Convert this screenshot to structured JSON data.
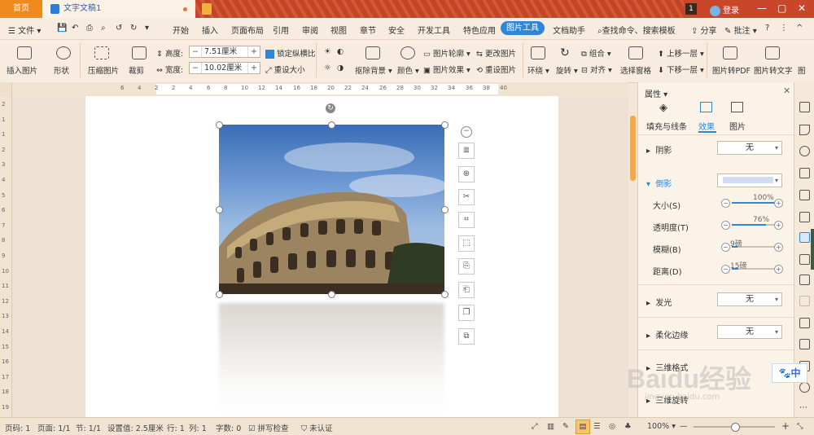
{
  "titlebar": {
    "home_tab": "首页",
    "doc_tab": "文字文稿1",
    "badge": "1",
    "login": "登录",
    "min": "—",
    "max": "▢",
    "close": "✕"
  },
  "menu": {
    "file": "文件",
    "items": [
      "开始",
      "插入",
      "页面布局",
      "引用",
      "审阅",
      "视图",
      "章节",
      "安全",
      "开发工具",
      "特色应用"
    ],
    "active": "图片工具",
    "assistant": "文档助手",
    "search": "查找命令、搜索模板",
    "share": "分享",
    "comment": "批注"
  },
  "ribbon": {
    "insert_picture": "插入图片",
    "shape": "形状",
    "compress": "压缩图片",
    "crop": "裁剪",
    "height_label": "高度:",
    "height_value": "7.51厘米",
    "width_label": "宽度:",
    "width_value": "10.02厘米",
    "lock_ratio": "锁定纵横比",
    "reset_size": "重设大小",
    "remove_bg": "抠除背景",
    "color": "颜色",
    "outline": "图片轮廓",
    "effect": "图片效果",
    "change": "更改图片",
    "reset_picture": "重设图片",
    "wrap": "环绕",
    "rotate": "旋转",
    "group": "组合",
    "align": "对齐",
    "select_pane": "选择窗格",
    "bring_forward": "上移一层",
    "send_backward": "下移一层",
    "to_pdf": "图片转PDF",
    "to_text": "图片转文字",
    "more": "图"
  },
  "ruler": {
    "ticks": [
      "6",
      "4",
      "2",
      "2",
      "4",
      "6",
      "8",
      "10",
      "12",
      "14",
      "16",
      "18",
      "20",
      "22",
      "24",
      "26",
      "28",
      "30",
      "32",
      "34",
      "36",
      "38",
      "40"
    ]
  },
  "vruler": {
    "ticks": [
      "2",
      "1",
      "1",
      "2",
      "3",
      "4",
      "5",
      "6",
      "7",
      "8",
      "9",
      "10",
      "11",
      "12",
      "13",
      "14",
      "15",
      "16",
      "17",
      "18",
      "19",
      "20"
    ]
  },
  "panel": {
    "title": "属性",
    "tabs": [
      "填充与线条",
      "效果",
      "图片"
    ],
    "shadow": {
      "label": "阴影",
      "value": "无"
    },
    "reflection": {
      "label": "倒影"
    },
    "size": {
      "label": "大小(S)",
      "value": "100%",
      "level": 1.0
    },
    "transparency": {
      "label": "透明度(T)",
      "value": "76%",
      "level": 0.76
    },
    "blur": {
      "label": "模糊(B)",
      "value": "9磅",
      "level": 0.12
    },
    "distance": {
      "label": "距离(D)",
      "value": "15磅",
      "level": 0.15
    },
    "glow": {
      "label": "发光",
      "value": "无"
    },
    "soft_edges": {
      "label": "柔化边缘",
      "value": "无"
    },
    "format_3d": "三维格式",
    "rotation_3d": "三维旋转"
  },
  "status": {
    "page_no": "页码: 1",
    "pages": "页面: 1/1",
    "section": "节: 1/1",
    "setting": "设置值: 2.5厘米",
    "row": "行: 1",
    "col": "列: 1",
    "words": "字数: 0",
    "spell": "拼写检查",
    "auth": "未认证",
    "zoom": "100%",
    "minus": "—",
    "plus": "+"
  },
  "overlay": {
    "watermark": "Baidu经验",
    "watermark_url": "jingyan.baidu.com",
    "ime": "中"
  }
}
